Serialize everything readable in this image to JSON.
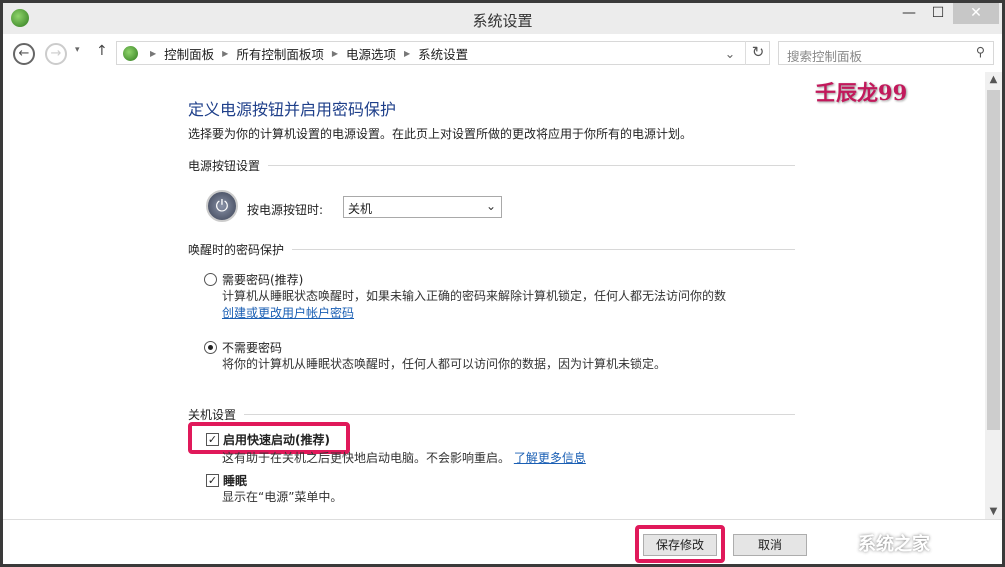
{
  "window": {
    "title": "系统设置",
    "minimize": "—",
    "maximize": "☐",
    "close": "✕"
  },
  "nav": {
    "back": "←",
    "forward": "→",
    "recent": "▾",
    "up": "↑",
    "breadcrumb": [
      "控制面板",
      "所有控制面板项",
      "电源选项",
      "系统设置"
    ],
    "search_placeholder": "搜索控制面板"
  },
  "watermark": "壬辰龙99",
  "page": {
    "heading": "定义电源按钮并启用密码保护",
    "subtitle": "选择要为你的计算机设置的电源设置。在此页上对设置所做的更改将应用于你所有的电源计划。"
  },
  "power_buttons": {
    "section": "电源按钮设置",
    "label": "按电源按钮时:",
    "value": "关机"
  },
  "wake_password": {
    "section": "唤醒时的密码保护",
    "options": [
      {
        "label": "需要密码(推荐)",
        "desc": "计算机从睡眠状态唤醒时，如果未输入正确的密码来解除计算机锁定，任何人都无法访问你的数",
        "link": "创建或更改用户帐户密码",
        "selected": false
      },
      {
        "label": "不需要密码",
        "desc": "将你的计算机从睡眠状态唤醒时，任何人都可以访问你的数据，因为计算机未锁定。",
        "selected": true
      }
    ]
  },
  "shutdown": {
    "section": "关机设置",
    "fast_startup": {
      "label": "启用快速启动(推荐)",
      "desc": "这有助于在关机之后更快地启动电脑。不会影响重启。",
      "link": "了解更多信息",
      "checked": true
    },
    "sleep": {
      "label": "睡眠",
      "desc": "显示在“电源”菜单中。",
      "checked": true
    }
  },
  "footer": {
    "save": "保存修改",
    "cancel": "取消",
    "logo": "系统之家"
  },
  "colors": {
    "highlight": "#e0195a",
    "heading": "#1e3f8a",
    "link": "#1a5fb4"
  }
}
